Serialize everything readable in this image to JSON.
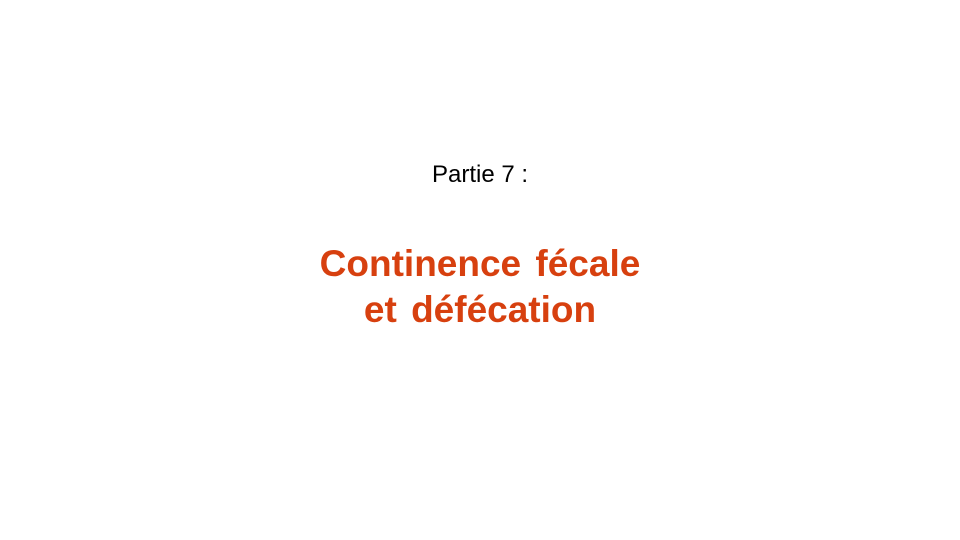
{
  "slide": {
    "subtitle": "Partie 7 :",
    "title_line_1": "Continence fécale",
    "title_line_2": "et défécation"
  },
  "colors": {
    "background": "#ffffff",
    "subtitle_text": "#000000",
    "title_text": "#d7400f"
  }
}
